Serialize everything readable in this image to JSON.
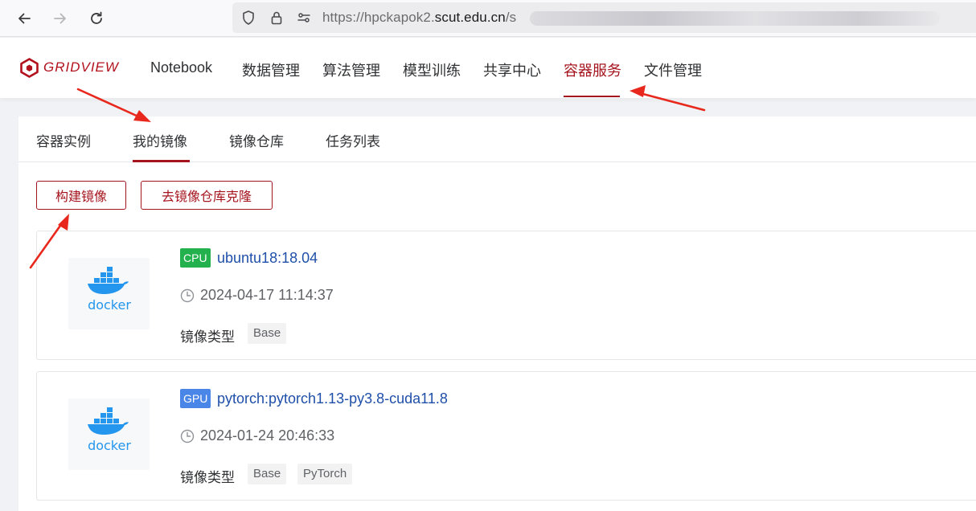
{
  "browser": {
    "url_prefix": "https://hpckapok2.",
    "url_host": "scut.edu.cn",
    "url_suffix": "/s"
  },
  "header": {
    "logo_text": "GRIDVIEW",
    "menu": [
      {
        "label": "Notebook"
      },
      {
        "label": "数据管理"
      },
      {
        "label": "算法管理"
      },
      {
        "label": "模型训练"
      },
      {
        "label": "共享中心"
      },
      {
        "label": "容器服务",
        "active": true
      },
      {
        "label": "文件管理"
      }
    ]
  },
  "tabs": [
    {
      "label": "容器实例"
    },
    {
      "label": "我的镜像",
      "active": true
    },
    {
      "label": "镜像仓库"
    },
    {
      "label": "任务列表"
    }
  ],
  "actions": {
    "build_label": "构建镜像",
    "clone_label": "去镜像仓库克隆"
  },
  "images": [
    {
      "hardware": "CPU",
      "name": "ubuntu18:18.04",
      "created": "2024-04-17 11:14:37",
      "type_label": "镜像类型",
      "tags": [
        "Base"
      ],
      "logo_text": "docker"
    },
    {
      "hardware": "GPU",
      "name": "pytorch:pytorch1.13-py3.8-cuda11.8",
      "created": "2024-01-24 20:46:33",
      "type_label": "镜像类型",
      "tags": [
        "Base",
        "PyTorch"
      ],
      "logo_text": "docker"
    }
  ],
  "colors": {
    "brand": "#a5141e",
    "cpu_badge": "#22b14c",
    "gpu_badge": "#4a86e8",
    "link": "#1f4fa8",
    "annotation_arrow": "#e8281c"
  },
  "icons": [
    "back-arrow-icon",
    "forward-arrow-icon",
    "reload-icon",
    "shield-icon",
    "lock-icon",
    "site-permissions-icon",
    "clock-icon",
    "docker-whale-icon",
    "gridview-logo-icon"
  ]
}
